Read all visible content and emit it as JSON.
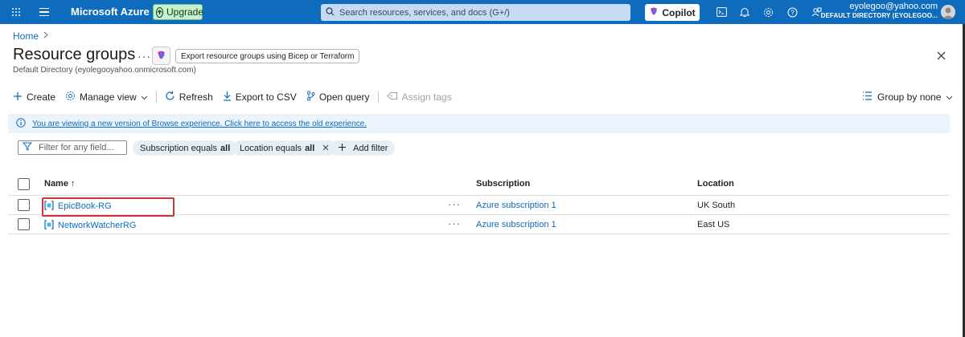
{
  "topbar": {
    "brand": "Microsoft Azure",
    "upgrade_label": "Upgrade",
    "search_placeholder": "Search resources, services, and docs (G+/)",
    "copilot_label": "Copilot",
    "account_email": "eyolegoo@yahoo.com",
    "account_directory": "DEFAULT DIRECTORY (EYOLEGOO...",
    "icons": [
      "app-launcher-icon",
      "hamburger-menu-icon",
      "cloud-shell-icon",
      "notifications-icon",
      "settings-icon",
      "help-icon",
      "feedback-icon"
    ]
  },
  "breadcrumb": {
    "home": "Home"
  },
  "header": {
    "title": "Resource groups",
    "more": "···",
    "export_label": "Export resource groups using Bicep or Terraform",
    "subtitle": "Default Directory (eyolegooyahoo.onmicrosoft.com)"
  },
  "toolbar": {
    "create": "Create",
    "manage_view": "Manage view",
    "refresh": "Refresh",
    "export_csv": "Export to CSV",
    "open_query": "Open query",
    "assign_tags": "Assign tags",
    "group_by": "Group by none"
  },
  "banner": {
    "text": "You are viewing a new version of Browse experience. Click here to access the old experience."
  },
  "filters": {
    "placeholder": "Filter for any field...",
    "subscription_prefix": "Subscription equals",
    "subscription_value": "all",
    "location_prefix": "Location equals",
    "location_value": "all",
    "add_filter": "Add filter"
  },
  "table": {
    "headers": {
      "name": "Name ↑",
      "subscription": "Subscription",
      "location": "Location"
    },
    "rows": [
      {
        "name": "EpicBook-RG",
        "more": "···",
        "subscription": "Azure subscription 1",
        "location": "UK South"
      },
      {
        "name": "NetworkWatcherRG",
        "more": "···",
        "subscription": "Azure subscription 1",
        "location": "East US"
      }
    ]
  },
  "colors": {
    "azure_blue": "#0f6cbd",
    "banner_bg": "#ebf3fc",
    "highlight_red": "#d13438"
  }
}
